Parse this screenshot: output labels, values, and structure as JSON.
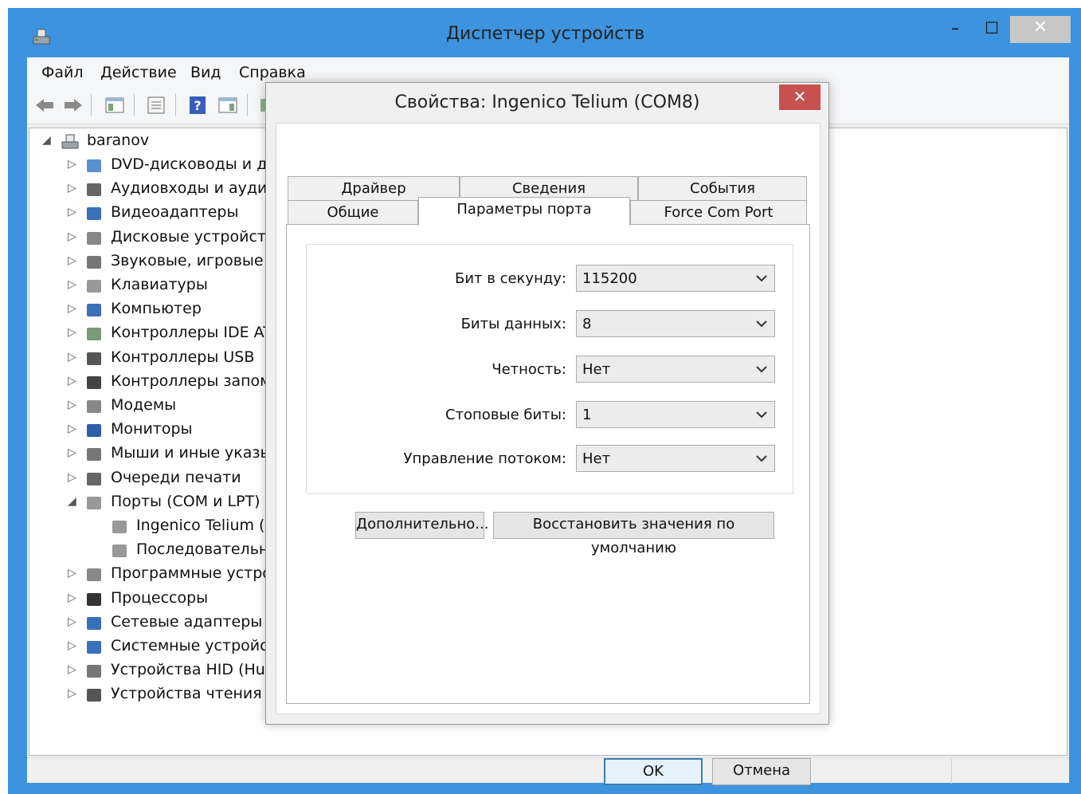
{
  "main": {
    "title": "Диспетчер устройств",
    "menu": [
      "Файл",
      "Действие",
      "Вид",
      "Справка"
    ],
    "tree": {
      "root": "baranov",
      "items": [
        {
          "label": "DVD-дисководы и ди",
          "arrow": "▷",
          "icon": "dvd-drive-icon",
          "indent": 1
        },
        {
          "label": "Аудиовходы и аудиоі",
          "arrow": "▷",
          "icon": "speaker-icon",
          "indent": 1
        },
        {
          "label": "Видеоадаптеры",
          "arrow": "▷",
          "icon": "display-adapter-icon",
          "indent": 1
        },
        {
          "label": "Дисковые устройств",
          "arrow": "▷",
          "icon": "disk-drive-icon",
          "indent": 1
        },
        {
          "label": "Звуковые, игровые и",
          "arrow": "▷",
          "icon": "sound-icon",
          "indent": 1
        },
        {
          "label": "Клавиатуры",
          "arrow": "▷",
          "icon": "keyboard-icon",
          "indent": 1
        },
        {
          "label": "Компьютер",
          "arrow": "▷",
          "icon": "computer-icon",
          "indent": 1
        },
        {
          "label": "Контроллеры IDE AT",
          "arrow": "▷",
          "icon": "ide-controller-icon",
          "indent": 1
        },
        {
          "label": "Контроллеры USB",
          "arrow": "▷",
          "icon": "usb-icon",
          "indent": 1
        },
        {
          "label": "Контроллеры запом",
          "arrow": "▷",
          "icon": "storage-controller-icon",
          "indent": 1
        },
        {
          "label": "Модемы",
          "arrow": "▷",
          "icon": "modem-icon",
          "indent": 1
        },
        {
          "label": "Мониторы",
          "arrow": "▷",
          "icon": "monitor-icon",
          "indent": 1
        },
        {
          "label": "Мыши и иные указы",
          "arrow": "▷",
          "icon": "mouse-icon",
          "indent": 1
        },
        {
          "label": "Очереди печати",
          "arrow": "▷",
          "icon": "printer-icon",
          "indent": 1
        },
        {
          "label": "Порты (COM и LPT)",
          "arrow": "◢",
          "icon": "port-icon",
          "indent": 1
        },
        {
          "label": "Ingenico Telium (",
          "arrow": "",
          "icon": "port-icon",
          "indent": 2
        },
        {
          "label": "Последовательны",
          "arrow": "",
          "icon": "port-icon",
          "indent": 2
        },
        {
          "label": "Программные устро",
          "arrow": "▷",
          "icon": "software-device-icon",
          "indent": 1
        },
        {
          "label": "Процессоры",
          "arrow": "▷",
          "icon": "processor-icon",
          "indent": 1
        },
        {
          "label": "Сетевые адаптеры",
          "arrow": "▷",
          "icon": "network-adapter-icon",
          "indent": 1
        },
        {
          "label": "Системные устройст",
          "arrow": "▷",
          "icon": "system-device-icon",
          "indent": 1
        },
        {
          "label": "Устройства HID (Hun",
          "arrow": "▷",
          "icon": "hid-icon",
          "indent": 1
        },
        {
          "label": "Устройства чтения сі",
          "arrow": "▷",
          "icon": "card-reader-icon",
          "indent": 1
        }
      ]
    }
  },
  "dialog": {
    "title": "Свойства: Ingenico Telium (COM8)",
    "tabs_row1": [
      "Драйвер",
      "Сведения",
      "События"
    ],
    "tabs_row2": [
      "Общие",
      "Параметры порта",
      "Force Com Port"
    ],
    "active_tab": "Параметры порта",
    "fields": [
      {
        "label": "Бит в секунду:",
        "value": "115200"
      },
      {
        "label": "Биты данных:",
        "value": "8"
      },
      {
        "label": "Четность:",
        "value": "Нет"
      },
      {
        "label": "Стоповые биты:",
        "value": "1"
      },
      {
        "label": "Управление потоком:",
        "value": "Нет"
      }
    ],
    "advanced_button": "Дополнительно...",
    "restore_button": "Восстановить значения по умолчанию",
    "ok_button": "OK",
    "cancel_button": "Отмена"
  },
  "colors": {
    "window_border": "#3d93de",
    "dialog_close": "#c75050",
    "default_button_border": "#3c7fb1"
  }
}
